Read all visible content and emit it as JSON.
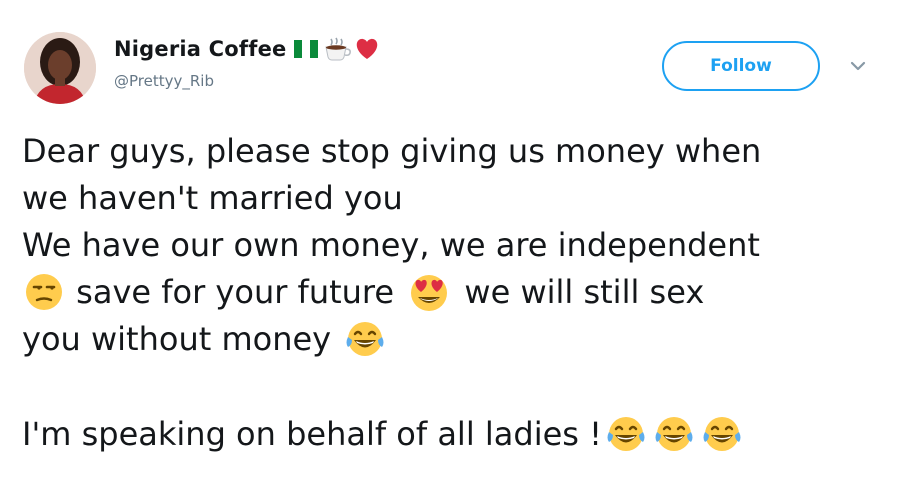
{
  "user": {
    "display_name": "Nigeria Coffee",
    "handle": "@Prettyy_Rib",
    "name_icons": [
      "nigeria-flag-icon",
      "coffee-icon",
      "red-heart-icon"
    ]
  },
  "follow_button": {
    "label": "Follow"
  },
  "caret": {
    "icon": "chevron-down-icon"
  },
  "tweet": {
    "line1": "Dear guys, please stop giving us money when",
    "line2": "we haven't married you",
    "line3": "We have our own money, we are independent",
    "line4_part1": "save for your future",
    "line4_part2": "we will still sex",
    "line5": "you without money",
    "line6": "I'm speaking on behalf of all ladies !",
    "emojis": [
      "unamused-face-icon",
      "heart-eyes-icon",
      "tears-of-joy-icon"
    ]
  },
  "colors": {
    "accent": "#1da1f2",
    "text": "#14171a",
    "muted": "#657786"
  }
}
